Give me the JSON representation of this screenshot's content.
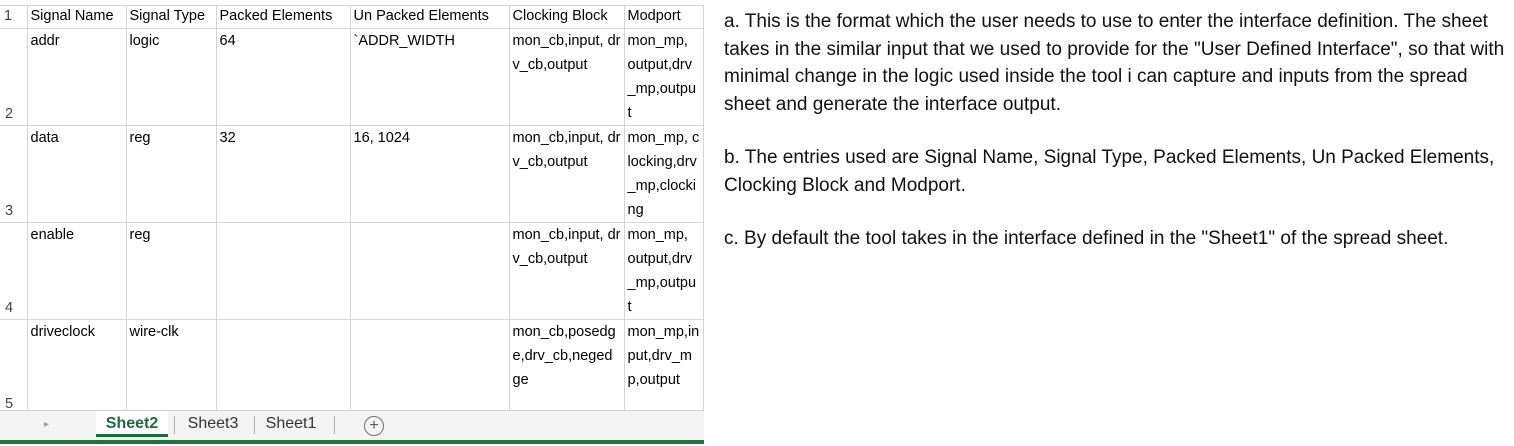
{
  "spreadsheet": {
    "headers": [
      "Signal Name",
      "Signal Type",
      "Packed Elements",
      "Un Packed Elements",
      "Clocking Block",
      "Modport"
    ],
    "rows": [
      {
        "num": "2",
        "cells": [
          "addr",
          "logic",
          "64",
          "`ADDR_WIDTH",
          "mon_cb,input, drv_cb,output",
          "mon_mp, output,drv_mp,output"
        ]
      },
      {
        "num": "3",
        "cells": [
          "data",
          "reg",
          "32",
          "16, 1024",
          "mon_cb,input, drv_cb,output",
          "mon_mp, clocking,drv_mp,clocking"
        ]
      },
      {
        "num": "4",
        "cells": [
          "enable",
          "reg",
          "",
          "",
          "mon_cb,input, drv_cb,output",
          "mon_mp, output,drv_mp,output"
        ]
      },
      {
        "num": "5",
        "cells": [
          "driveclock",
          "wire-clk",
          "",
          "",
          "mon_cb,posedge,drv_cb,negedge",
          "mon_mp,input,drv_mp,output"
        ]
      }
    ],
    "header_row_num": "1",
    "tabs": [
      "Sheet2",
      "Sheet3",
      "Sheet1"
    ],
    "active_tab": "Sheet2",
    "add_sheet_symbol": "+",
    "scroll_arrow": "▸",
    "accent_color": "#217346"
  },
  "notes": [
    "a. This is the format which the user needs to use to enter the interface definition. The sheet takes in the similar input that we used to provide for the \"User Defined Interface\", so that with minimal change in the logic used inside the tool i can capture and inputs from the spread sheet and generate the interface output.",
    "b. The entries used are Signal Name, Signal Type, Packed Elements, Un Packed Elements, Clocking Block and Modport.",
    "c. By default the tool takes in the interface defined in the \"Sheet1\" of the spread sheet."
  ]
}
